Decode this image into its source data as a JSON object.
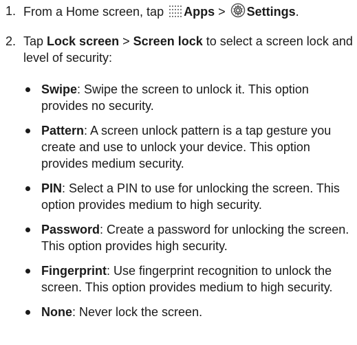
{
  "steps": [
    {
      "number": "1.",
      "prefix": "From a Home screen, tap",
      "apps": "Apps",
      "separator": ">",
      "settings": "Settings",
      "end": ".",
      "apps_icon": "apps-grid-icon",
      "settings_icon": "settings-gear-icon"
    },
    {
      "number": "2.",
      "prefix": "Tap",
      "lock_screen": "Lock screen",
      "separator": ">",
      "screen_lock": "Screen lock",
      "suffix": "to select a screen lock and level of security:"
    }
  ],
  "options": [
    {
      "name": "Swipe",
      "text": ": Swipe the screen to unlock it. This option provides no security."
    },
    {
      "name": "Pattern",
      "text": ": A screen unlock pattern is a tap gesture you create and use to unlock your device. This option provides medium security."
    },
    {
      "name": "PIN",
      "text": ": Select a PIN to use for unlocking the screen. This option provides medium to high security."
    },
    {
      "name": "Password",
      "text": ": Create a password for unlocking the screen. This option provides high security."
    },
    {
      "name": "Fingerprint",
      "text": ": Use fingerprint recognition to unlock the screen. This option provides medium to high security."
    },
    {
      "name": "None",
      "text": ": Never lock the screen."
    }
  ]
}
